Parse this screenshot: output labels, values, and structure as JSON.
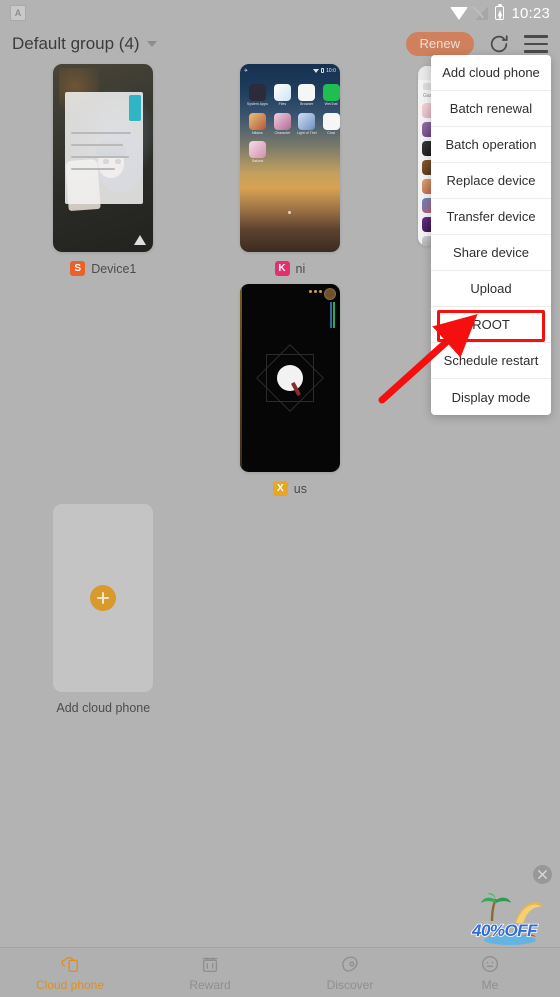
{
  "statusbar": {
    "app_icon_name": "app-badge-icon",
    "app_icon_glyph": "A",
    "wifi_icon": "wifi-icon",
    "signal_icon": "signal-off-icon",
    "battery_icon": "battery-charging-icon",
    "clock": "10:23"
  },
  "header": {
    "group_label": "Default group (4)",
    "dropdown_icon": "chevron-down-icon",
    "renew_label": "Renew",
    "refresh_icon": "refresh-icon",
    "menu_icon": "hamburger-menu-icon"
  },
  "devices": [
    {
      "name": "Device1",
      "badge": "S",
      "badge_color": "#e8622a",
      "screen": "anime-wallpaper"
    },
    {
      "name": "ni",
      "badge": "K",
      "badge_color": "#e4306b",
      "screen": "android-home"
    },
    {
      "name": "us",
      "badge": "X",
      "badge_color": "#e8a722",
      "screen": "dark-game"
    }
  ],
  "add_card": {
    "label": "Add cloud phone",
    "plus_icon": "plus-icon",
    "plus_color": "#d79a2b"
  },
  "home_screen_apps": [
    {
      "name": "System Apps",
      "color": "#2b2b3a"
    },
    {
      "name": "Files",
      "color": "#f2f4f7"
    },
    {
      "name": "Browser",
      "color": "#f4f4f4"
    },
    {
      "name": "WeChat",
      "color": "#1fbd52"
    },
    {
      "name": "Nikkes",
      "color": "#c9a060"
    },
    {
      "name": "Character",
      "color": "#e6a8c4"
    },
    {
      "name": "Light of Thel",
      "color": "#7fa8d8"
    },
    {
      "name": "Chat",
      "color": "#f4f4f4"
    },
    {
      "name": "Sakura",
      "color": "#e7c6d6"
    }
  ],
  "menu": {
    "items": [
      {
        "label": "Add cloud phone",
        "highlighted": false
      },
      {
        "label": "Batch renewal",
        "highlighted": false
      },
      {
        "label": "Batch operation",
        "highlighted": false
      },
      {
        "label": "Replace device",
        "highlighted": false
      },
      {
        "label": "Transfer device",
        "highlighted": false
      },
      {
        "label": "Share device",
        "highlighted": false
      },
      {
        "label": "Upload",
        "highlighted": false
      },
      {
        "label": "ROOT",
        "highlighted": true
      },
      {
        "label": "Schedule restart",
        "highlighted": false
      },
      {
        "label": "Display mode",
        "highlighted": false
      }
    ]
  },
  "annotation": {
    "highlight_color": "#f50f0f",
    "arrow_name": "pointer-arrow",
    "target_label": "ROOT"
  },
  "promo": {
    "text": "40%OFF",
    "close_icon": "close-icon",
    "art": "beach-palm-surfboard"
  },
  "bottomnav": {
    "items": [
      {
        "label": "Cloud phone",
        "icon": "cloud-phone-icon",
        "active": true
      },
      {
        "label": "Reward",
        "icon": "gift-box-icon",
        "active": false
      },
      {
        "label": "Discover",
        "icon": "compass-icon",
        "active": false
      },
      {
        "label": "Me",
        "icon": "profile-icon",
        "active": false
      }
    ],
    "active_color": "#dd8f22",
    "inactive_color": "#8f8f8f"
  }
}
